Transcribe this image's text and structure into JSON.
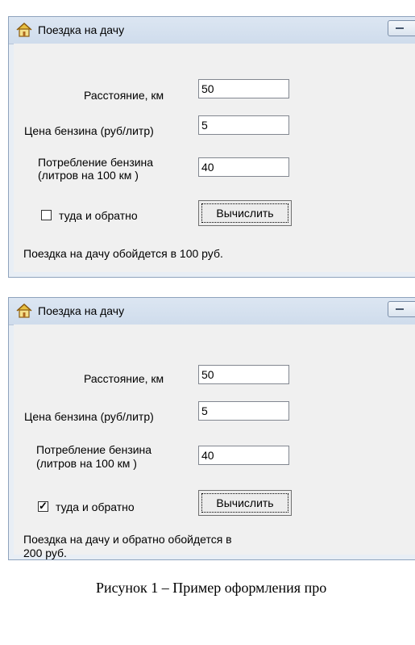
{
  "windows": [
    {
      "title": "Поездка на дачу",
      "distance_label": "Расстояние, км",
      "distance_value": "50",
      "price_label": "Цена бензина (руб/литр)",
      "price_value": "5",
      "consumption_label_line1": "Потребление бензина",
      "consumption_label_line2": "(литров на 100 км )",
      "consumption_value": "40",
      "roundtrip_label": "туда и обратно",
      "roundtrip_checked": false,
      "compute_button": "Вычислить",
      "result_line1": "Поездка на дачу  обойдется в 100 руб.",
      "result_line2": ""
    },
    {
      "title": "Поездка на дачу",
      "distance_label": "Расстояние, км",
      "distance_value": "50",
      "price_label": "Цена бензина (руб/литр)",
      "price_value": "5",
      "consumption_label_line1": "Потребление бензина",
      "consumption_label_line2": "(литров на 100 км )",
      "consumption_value": "40",
      "roundtrip_label": "туда и обратно",
      "roundtrip_checked": true,
      "compute_button": "Вычислить",
      "result_line1": "Поездка на дачу  и обратно  обойдется в",
      "result_line2": "200 руб."
    }
  ],
  "figure_caption": "Рисунок 1 – Пример оформления про",
  "icons": {
    "window_icon": "house-icon",
    "minimize": "minimize-icon",
    "check": "checkmark-icon"
  }
}
